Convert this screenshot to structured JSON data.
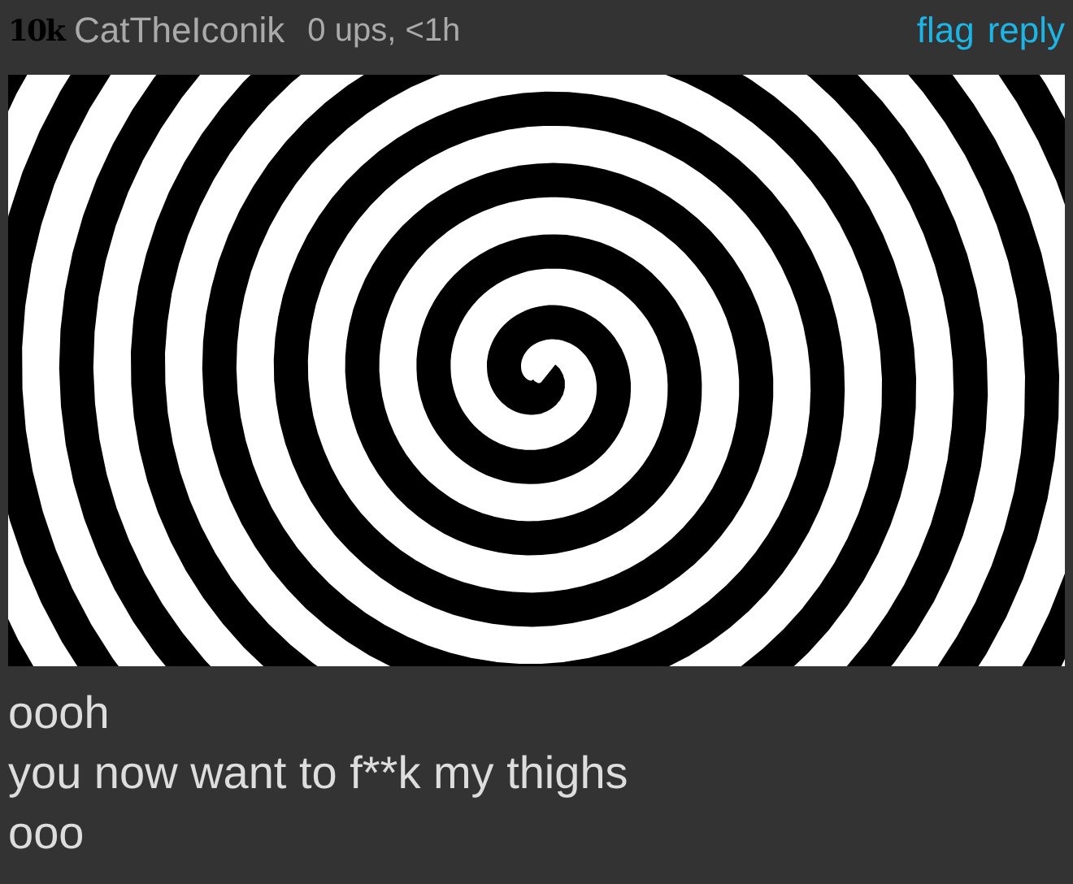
{
  "comment": {
    "points": "10k",
    "username": "CatTheIconik",
    "meta": "0 ups, <1h",
    "actions": [
      "flag",
      "reply"
    ],
    "image": {
      "kind": "picture"
    },
    "lines": [
      "oooh",
      "you now want to f**k my thighs",
      "ooo"
    ]
  }
}
